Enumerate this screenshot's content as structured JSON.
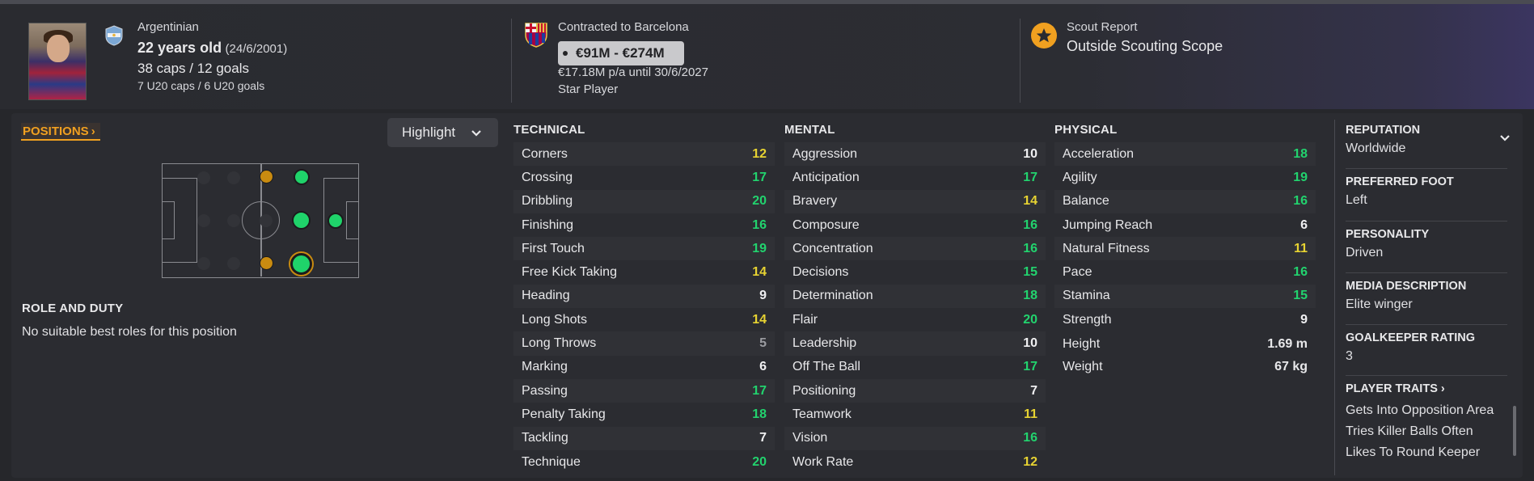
{
  "player": {
    "nationality": "Argentinian",
    "age": "22 years old",
    "dob": "(24/6/2001)",
    "caps_goals": "38 caps / 12 goals",
    "u20": "7 U20 caps / 6 U20 goals"
  },
  "contract": {
    "club_line": "Contracted to Barcelona",
    "value_range": "€91M - €274M",
    "wage": "€17.18M p/a until 30/6/2027",
    "status": "Star Player"
  },
  "scout": {
    "label": "Scout Report",
    "value": "Outside Scouting Scope"
  },
  "positions_label": "POSITIONS",
  "highlight_label": "Highlight",
  "role": {
    "heading": "ROLE AND DUTY",
    "text": "No suitable best roles for this position"
  },
  "technical": {
    "heading": "TECHNICAL",
    "attrs": [
      {
        "name": "Corners",
        "value": "12"
      },
      {
        "name": "Crossing",
        "value": "17"
      },
      {
        "name": "Dribbling",
        "value": "20"
      },
      {
        "name": "Finishing",
        "value": "16"
      },
      {
        "name": "First Touch",
        "value": "19"
      },
      {
        "name": "Free Kick Taking",
        "value": "14"
      },
      {
        "name": "Heading",
        "value": "9"
      },
      {
        "name": "Long Shots",
        "value": "14"
      },
      {
        "name": "Long Throws",
        "value": "5"
      },
      {
        "name": "Marking",
        "value": "6"
      },
      {
        "name": "Passing",
        "value": "17"
      },
      {
        "name": "Penalty Taking",
        "value": "18"
      },
      {
        "name": "Tackling",
        "value": "7"
      },
      {
        "name": "Technique",
        "value": "20"
      }
    ]
  },
  "mental": {
    "heading": "MENTAL",
    "attrs": [
      {
        "name": "Aggression",
        "value": "10"
      },
      {
        "name": "Anticipation",
        "value": "17"
      },
      {
        "name": "Bravery",
        "value": "14"
      },
      {
        "name": "Composure",
        "value": "16"
      },
      {
        "name": "Concentration",
        "value": "16"
      },
      {
        "name": "Decisions",
        "value": "15"
      },
      {
        "name": "Determination",
        "value": "18"
      },
      {
        "name": "Flair",
        "value": "20"
      },
      {
        "name": "Leadership",
        "value": "10"
      },
      {
        "name": "Off The Ball",
        "value": "17"
      },
      {
        "name": "Positioning",
        "value": "7"
      },
      {
        "name": "Teamwork",
        "value": "11"
      },
      {
        "name": "Vision",
        "value": "16"
      },
      {
        "name": "Work Rate",
        "value": "12"
      }
    ]
  },
  "physical": {
    "heading": "PHYSICAL",
    "attrs": [
      {
        "name": "Acceleration",
        "value": "18"
      },
      {
        "name": "Agility",
        "value": "19"
      },
      {
        "name": "Balance",
        "value": "16"
      },
      {
        "name": "Jumping Reach",
        "value": "6"
      },
      {
        "name": "Natural Fitness",
        "value": "11"
      },
      {
        "name": "Pace",
        "value": "16"
      },
      {
        "name": "Stamina",
        "value": "15"
      },
      {
        "name": "Strength",
        "value": "9"
      }
    ],
    "height_label": "Height",
    "height": "1.69 m",
    "weight_label": "Weight",
    "weight": "67 kg"
  },
  "side": {
    "reputation_label": "REPUTATION",
    "reputation": "Worldwide",
    "foot_label": "PREFERRED FOOT",
    "foot": "Left",
    "personality_label": "PERSONALITY",
    "personality": "Driven",
    "media_label": "MEDIA DESCRIPTION",
    "media": "Elite winger",
    "gk_label": "GOALKEEPER RATING",
    "gk": "3",
    "traits_label": "PLAYER TRAITS",
    "traits": [
      "Gets Into Opposition Area",
      "Tries Killer Balls Often",
      "Likes To Round Keeper"
    ]
  },
  "colors": {
    "green": "#22d36e",
    "yellow": "#e7d332",
    "white": "#f0f0f2",
    "grey": "#9b9ca1",
    "accent": "#f0a020",
    "dot_green": "#1fd36a",
    "dot_amber": "#c98b10"
  }
}
